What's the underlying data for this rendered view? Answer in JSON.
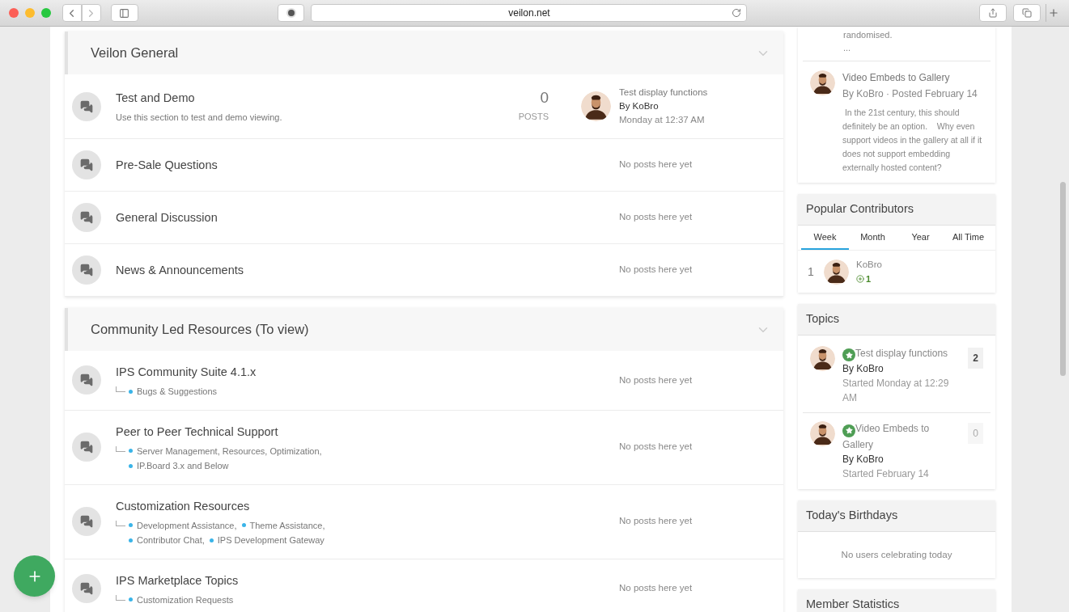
{
  "browser": {
    "address": "veilon.net"
  },
  "categories": [
    {
      "title": "Veilon General",
      "expanded": true,
      "forums": [
        {
          "title": "Test and Demo",
          "description": "Use this section to test and demo viewing.",
          "posts_count": "0",
          "posts_label": "POSTS",
          "last_post": {
            "title": "Test display functions",
            "author": "By KoBro",
            "time": "Monday at 12:37 AM"
          }
        },
        {
          "title": "Pre-Sale Questions",
          "no_posts": "No posts here yet"
        },
        {
          "title": "General Discussion",
          "no_posts": "No posts here yet"
        },
        {
          "title": "News & Announcements",
          "no_posts": "No posts here yet"
        }
      ]
    },
    {
      "title": "Community Led Resources (To view)",
      "expanded": true,
      "forums": [
        {
          "title": "IPS Community Suite 4.1.x",
          "subforums": [
            "Bugs & Suggestions"
          ],
          "no_posts": "No posts here yet"
        },
        {
          "title": "Peer to Peer Technical Support",
          "subforums": [
            "Server Management, Resources, Optimization,",
            "IP.Board 3.x and Below"
          ],
          "no_posts": "No posts here yet"
        },
        {
          "title": "Customization Resources",
          "subforums": [
            "Development Assistance,",
            "Theme Assistance,",
            "Contributor Chat,",
            "IPS Development Gateway"
          ],
          "no_posts": "No posts here yet"
        },
        {
          "title": "IPS Marketplace Topics",
          "subforums": [
            "Customization Requests"
          ],
          "no_posts": "No posts here yet"
        }
      ]
    }
  ],
  "sidebar": {
    "recent_posts": {
      "cut_text": "randomised.",
      "ellipsis": "...",
      "posts": [
        {
          "title": "Video Embeds to Gallery",
          "meta": "By KoBro · Posted February 14",
          "excerpt": " In the 21st century, this should definitely be an option.    Why even support videos in the gallery at all if it does not support embedding externally hosted content?"
        }
      ]
    },
    "popular_contributors": {
      "title": "Popular Contributors",
      "tabs": [
        {
          "label": "Week",
          "selected": true
        },
        {
          "label": "Month",
          "selected": false
        },
        {
          "label": "Year",
          "selected": false
        },
        {
          "label": "All Time",
          "selected": false
        }
      ],
      "rows": [
        {
          "rank": "1",
          "name": "KoBro",
          "reputation": "1"
        }
      ]
    },
    "topics": {
      "title": "Topics",
      "items": [
        {
          "title": "Test display functions",
          "author": "By KoBro",
          "started": "Started Monday at 12:29 AM",
          "replies": "2",
          "has_replies": true
        },
        {
          "title": "Video Embeds to Gallery",
          "author": "By KoBro",
          "started": "Started February 14",
          "replies": "0",
          "has_replies": false
        }
      ]
    },
    "birthdays": {
      "title": "Today's Birthdays",
      "empty": "No users celebrating today"
    },
    "member_statistics": {
      "title": "Member Statistics"
    }
  }
}
